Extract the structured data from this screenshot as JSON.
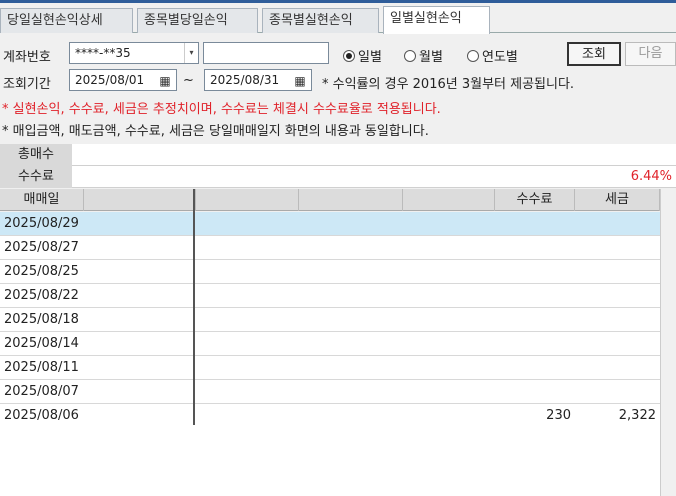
{
  "tabs": [
    {
      "label": "당일실현손익상세"
    },
    {
      "label": "종목별당일손익"
    },
    {
      "label": "종목별실현손익"
    },
    {
      "label": "일별실현손익"
    }
  ],
  "account": {
    "label": "계좌번호",
    "value": "****-**35",
    "name_value": "",
    "periods": [
      {
        "label": "일별",
        "selected": true
      },
      {
        "label": "월별",
        "selected": false
      },
      {
        "label": "연도별",
        "selected": false
      }
    ],
    "query_button": "조회",
    "next_button": "다음"
  },
  "period": {
    "label": "조회기간",
    "from": "2025/08/01",
    "tilde": "~",
    "to": "2025/08/31",
    "note": "* 수익률의 경우 2016년 3월부터 제공됩니다."
  },
  "notes": {
    "red": "* 실현손익, 수수료, 세금은 추정치이며, 수수료는 체결시 수수료율로 적용됩니다.",
    "black": "* 매입금액, 매도금액, 수수료, 세금은 당일매매일지 화면의 내용과 동일합니다."
  },
  "summary": {
    "row1_label": "총매수",
    "row2_label": "수수료",
    "rate_value": "6.44%"
  },
  "grid": {
    "columns": [
      "매매일",
      "",
      "",
      "",
      "",
      "수수료",
      "세금"
    ],
    "rows": [
      {
        "date": "2025/08/29"
      },
      {
        "date": "2025/08/27"
      },
      {
        "date": "2025/08/25"
      },
      {
        "date": "2025/08/22"
      },
      {
        "date": "2025/08/18"
      },
      {
        "date": "2025/08/14"
      },
      {
        "date": "2025/08/11"
      },
      {
        "date": "2025/08/07"
      },
      {
        "date": "2025/08/06",
        "fee": "230",
        "tax": "2,322"
      }
    ]
  },
  "colors": {
    "accent": "#2f5d9a",
    "red": "#e0222a",
    "selected_row": "#cde8f6"
  }
}
